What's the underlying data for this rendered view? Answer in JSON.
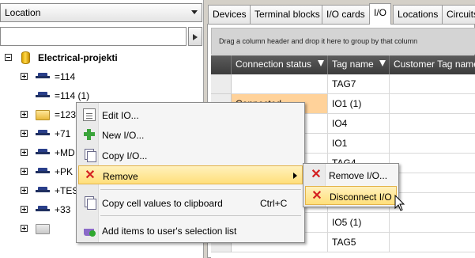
{
  "location_combo": {
    "value": "Location"
  },
  "filter": {
    "value": "",
    "placeholder": ""
  },
  "tree": {
    "root_label": "Electrical-projekti",
    "items": [
      "=114",
      "=114 (1)",
      "=123",
      "+71",
      "+MD",
      "+PK",
      "+TES",
      "+33",
      ""
    ]
  },
  "tabs": [
    "Devices",
    "Terminal blocks",
    "I/O cards",
    "I/O",
    "Locations",
    "Circuits"
  ],
  "active_tab": "I/O",
  "grid": {
    "group_hint": "Drag a column header and drop it here to group by that column",
    "columns": [
      "Connection status",
      "Tag name",
      "Customer Tag name"
    ],
    "rows": [
      [
        "",
        "TAG7",
        ""
      ],
      [
        "Connected",
        "IO1 (1)",
        ""
      ],
      [
        "",
        "IO4",
        ""
      ],
      [
        "",
        "IO1",
        ""
      ],
      [
        "",
        "TAG4",
        ""
      ],
      [
        "",
        "",
        ""
      ],
      [
        "",
        "",
        ""
      ],
      [
        "e con",
        "IO5 (1)",
        ""
      ],
      [
        "",
        "TAG5",
        ""
      ]
    ]
  },
  "context_menu": {
    "items": [
      {
        "label": "Edit IO...",
        "icon": "edit-document-icon"
      },
      {
        "label": "New I/O...",
        "icon": "add-plus-icon"
      },
      {
        "label": "Copy I/O...",
        "icon": "copy-icon"
      },
      {
        "label": "Remove",
        "icon": "remove-x-icon",
        "submenu": true
      },
      {
        "label": "Copy cell values to clipboard",
        "shortcut": "Ctrl+C",
        "icon": "clipboard-copy-icon"
      },
      {
        "label": "Add items to user's selection list",
        "icon": "selection-basket-icon"
      }
    ]
  },
  "submenu": {
    "items": [
      {
        "label": "Remove I/O...",
        "icon": "remove-x-icon"
      },
      {
        "label": "Disconnect I/O",
        "icon": "disconnect-x-icon"
      }
    ]
  },
  "colors": {
    "menu_highlight": "#ffdf7a",
    "row_highlight": "#ffd29a",
    "header_dark": "#4a4a4a",
    "remove_red": "#d42020"
  }
}
